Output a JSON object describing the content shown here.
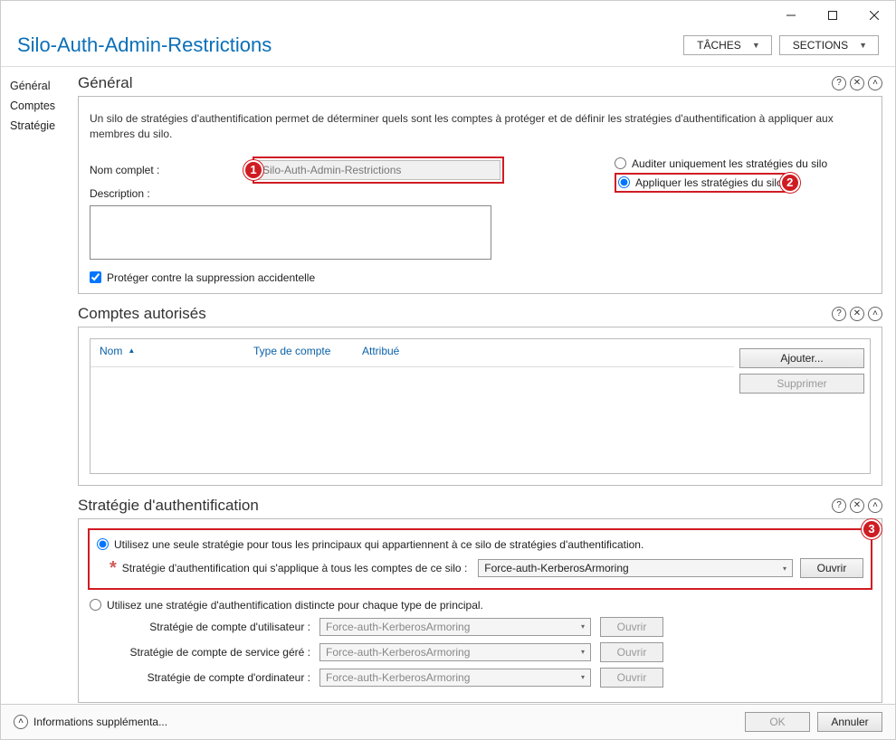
{
  "window": {
    "title": "Silo-Auth-Admin-Restrictions"
  },
  "header": {
    "tasks_label": "TÂCHES",
    "sections_label": "SECTIONS"
  },
  "sidebar": {
    "items": [
      {
        "label": "Général"
      },
      {
        "label": "Comptes"
      },
      {
        "label": "Stratégie"
      }
    ]
  },
  "general": {
    "title": "Général",
    "description": "Un silo de stratégies d'authentification permet de déterminer quels sont les comptes à protéger et de définir les stratégies d'authentification à appliquer aux membres du silo.",
    "name_label": "Nom complet :",
    "name_value": "Silo-Auth-Admin-Restrictions",
    "description_label": "Description :",
    "protect_label": "Protéger contre la suppression accidentelle",
    "audit_label": "Auditer uniquement les stratégies du silo",
    "apply_label": "Appliquer les stratégies du silo"
  },
  "accounts": {
    "title": "Comptes autorisés",
    "col_name": "Nom",
    "col_type": "Type de compte",
    "col_attr": "Attribué",
    "add_btn": "Ajouter...",
    "remove_btn": "Supprimer"
  },
  "strategy": {
    "title": "Stratégie d'authentification",
    "single_label": "Utilisez une seule stratégie pour tous les principaux qui appartiennent à ce silo de stratégies d'authentification.",
    "applies_label": "Stratégie d'authentification qui s'applique à tous les comptes de ce silo :",
    "combo_value": "Force-auth-KerberosArmoring",
    "open_btn": "Ouvrir",
    "distinct_label": "Utilisez une stratégie d'authentification distincte pour chaque type de principal.",
    "user_label": "Stratégie de compte d'utilisateur :",
    "service_label": "Stratégie de compte de service géré :",
    "computer_label": "Stratégie de compte d'ordinateur :"
  },
  "footer": {
    "info_label": "Informations supplémenta...",
    "ok": "OK",
    "cancel": "Annuler"
  },
  "callouts": {
    "c1": "1",
    "c2": "2",
    "c3": "3"
  }
}
